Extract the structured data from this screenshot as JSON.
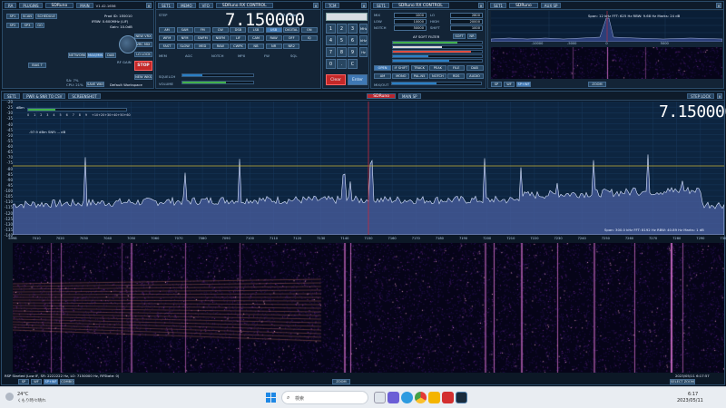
{
  "top_bar": {
    "remote_label": "RA",
    "plugins_label": "PLUGINS",
    "app_title": "SDRuno",
    "main_label": "MAIN",
    "version": "V1.42.1656"
  },
  "main_panel": {
    "buttons": [
      "SP1",
      "SCAN",
      "SCHEDULE",
      "SP2",
      "SP3",
      "GO",
      "BIAS T",
      "NEW VRX",
      "VRC MIX",
      "NETWORK",
      "MAX/MIN",
      "DAB",
      "LO LOCK",
      "STOP",
      "NEW WKS",
      "SAVE WKS"
    ],
    "status": [
      "Prod ID: 1E0010",
      "IFBW: 0.600MHz (LIF)",
      "Gain: 10.0dB"
    ],
    "rf_gain": "RF GAIN",
    "workspace": "Default Workspace",
    "sa_labels": [
      "SA: 7%",
      "CPU: 21%"
    ],
    "stop_label": "STOP"
  },
  "rx_control": {
    "title": "SDRuno RX CONTROL",
    "set_label": "SET1",
    "mem_label": "MEMO",
    "vfo_label": "VFO",
    "frequency": "7.150000",
    "step_label": "STEP",
    "snr": "-97.9 dBm",
    "mode_buttons": [
      "AM",
      "SAM",
      "FM",
      "CW",
      "DSB",
      "LSB",
      "USB",
      "DIGITAL",
      "ON",
      "WFM",
      "NFM",
      "SWFM",
      "NBFM",
      "LIF",
      "CAM",
      "RAW",
      "OFF",
      "IQ",
      "FAST",
      "SLOW",
      "MED",
      "RAW",
      "CWPK",
      "NB",
      "NR",
      "NR2"
    ],
    "labels": [
      "MEM",
      "AGC",
      "NOTCH",
      "MPX",
      "FW",
      "SQL"
    ],
    "volume_label": "VOLUME",
    "squelch_label": "SQUELCH",
    "vol_value": 0.62,
    "sq_value": 0.28
  },
  "keypad": {
    "title": "TCM",
    "keys": [
      "1",
      "2",
      "3",
      "4",
      "5",
      "6",
      "7",
      "8",
      "9",
      "0",
      ".",
      "C"
    ],
    "side": [
      "MHz",
      "kHz",
      "Hz"
    ],
    "clear": "Clear",
    "enter": "Enter"
  },
  "rx_filter": {
    "title": "SDRuno RX CONTROL",
    "set_label": "SET1",
    "fields": [
      "MIX",
      "LO",
      "LOW",
      "HIGH",
      "NOTCH",
      "SHIFT"
    ],
    "values": [
      "1000",
      "2800",
      "10000",
      "20000",
      "50000",
      "1000"
    ],
    "af_soft_filter": "AF SOFT FILTER",
    "soft_label": "SOFT",
    "nr_label": "NR",
    "bars": [
      0.72,
      0.55,
      0.88,
      0.4,
      0.63
    ],
    "open_label": "OPEN",
    "mode_buttons": [
      "OPEN",
      "IF SHIFT",
      "TRACK",
      "PEAK",
      "FILE",
      "DAB"
    ],
    "demod_buttons": [
      "AM",
      "MONO",
      "PAL-N5",
      "NOTCH",
      "RDS",
      "AUDIO"
    ],
    "mix_label": "MIX/OUT"
  },
  "aux_sp": {
    "title": "SDRuno",
    "sub": "AUX SP",
    "readout": "Span: 12 kHz   FFT: 625 Hz   RBW: 9.68 Hz   Marks: 24 dB",
    "ticks": [
      "-10000",
      "-5000",
      "0",
      "5000"
    ],
    "zoom": "ZOOM",
    "sp_label": "SP",
    "wf_label": "WF",
    "spwf_label": "SP+WF"
  },
  "main_sp": {
    "set_label": "SET1",
    "pwr_label": "PWR & SNR TO CSV",
    "screenshot_label": "SCREENSHOT",
    "title": "SDRuno",
    "sub": "MAIN SP",
    "step_lock": "STEP LOCK",
    "frequency": "7.150000",
    "dbfs": "dBm",
    "smeter_scale": [
      "0",
      "1",
      "2",
      "3",
      "4",
      "5",
      "6",
      "7",
      "8",
      "9",
      "+10",
      "+20",
      "+30",
      "+40",
      "+50",
      "+60"
    ],
    "signal_level": "-97.9 dBm   SNR: -- dB",
    "y_ticks": [
      "-20",
      "-25",
      "-30",
      "-35",
      "-40",
      "-45",
      "-50",
      "-55",
      "-60",
      "-65",
      "-70",
      "-75",
      "-80",
      "-85",
      "-90",
      "-95",
      "-100",
      "-105",
      "-110",
      "-115",
      "-120",
      "-125",
      "-130",
      "-135",
      "-140"
    ],
    "x_ticks": [
      "6998",
      "7010",
      "7020",
      "7030",
      "7040",
      "7050",
      "7060",
      "7070",
      "7080",
      "7090",
      "7100",
      "7110",
      "7120",
      "7130",
      "7140",
      "7150",
      "7160",
      "7170",
      "7180",
      "7190",
      "7200",
      "7210",
      "7220",
      "7230",
      "7240",
      "7250",
      "7260",
      "7270",
      "7280",
      "7290",
      "7300"
    ],
    "readout": "Span: 300.0 kHz   FFT: 8192 Hz   RBW: 40.89 Hz   Marks: 1 dB",
    "status": "RSP Started (Low IF, SR: 2222222 Hz, LO: 7150000 Hz, RFState: 0)",
    "timestamp": "2023/05/11 6:17:57",
    "zoom": "ZOOM",
    "sp_label": "SP",
    "wf_label": "WF",
    "spwf_label": "SP+WF",
    "combo_label": "COMBO",
    "select_label": "SELECT ZOOM"
  },
  "taskbar": {
    "weather_temp": "24°C",
    "weather_text": "くもり時々晴れ",
    "search_placeholder": "検索",
    "time": "6:17",
    "date": "2023/05/11"
  },
  "colors": {
    "spectrum_fill": "#4a5fa0",
    "spectrum_line": "#dde8ff",
    "yellow_line": "#c8b43a",
    "red_line": "#c8283a",
    "stop_red": "#c42828"
  }
}
